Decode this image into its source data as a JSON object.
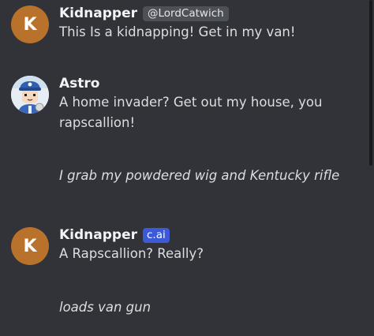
{
  "messages": [
    {
      "avatar_letter": "K",
      "name": "Kidnapper",
      "badge": "@LordCatwich",
      "lines": [
        "This Is a kidnapping! Get in my van!"
      ]
    },
    {
      "name": "Astro",
      "avatar_icon": "cartoon-character-avatar-icon",
      "lines": [
        "A home invader? Get out my house, you",
        "rapscallion!",
        "I grab my powdered wig and Kentucky rifle"
      ]
    },
    {
      "avatar_letter": "K",
      "name": "Kidnapper",
      "badge": "c.ai",
      "lines": [
        "A Rapscallion?  Really?",
        "loads van gun"
      ]
    }
  ],
  "colors": {
    "background": "#313338",
    "avatar_k": "#b9722b",
    "badge_cai": "#3c59d6",
    "badge_handle": "#4e5058"
  }
}
